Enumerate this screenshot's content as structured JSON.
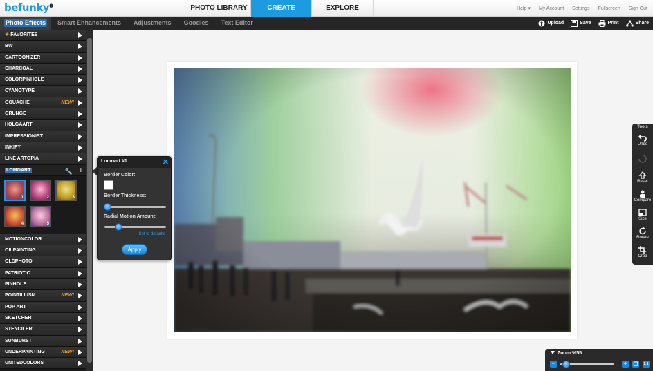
{
  "logo": {
    "text": "befunky"
  },
  "main_nav": [
    {
      "label": "PHOTO LIBRARY",
      "active": false
    },
    {
      "label": "CREATE",
      "active": true
    },
    {
      "label": "EXPLORE",
      "active": false
    }
  ],
  "top_links": [
    "Help ▾",
    "My Account",
    "Settings",
    "Fullscreen",
    "Sign Out"
  ],
  "tabs": [
    {
      "label": "Photo Effects",
      "active": true
    },
    {
      "label": "Smart Enhancements",
      "active": false
    },
    {
      "label": "Adjustments",
      "active": false
    },
    {
      "label": "Goodies",
      "active": false
    },
    {
      "label": "Text Editor",
      "active": false
    }
  ],
  "actions": [
    {
      "label": "Upload",
      "icon": "upload-icon"
    },
    {
      "label": "Save",
      "icon": "save-icon"
    },
    {
      "label": "Print",
      "icon": "print-icon"
    },
    {
      "label": "Share",
      "icon": "share-icon"
    }
  ],
  "effects_top": [
    {
      "label": "FAVORITES",
      "badge": ""
    },
    {
      "label": "BW",
      "badge": ""
    },
    {
      "label": "CARTOONIZER",
      "badge": ""
    },
    {
      "label": "CHARCOAL",
      "badge": ""
    },
    {
      "label": "COLORPINHOLE",
      "badge": ""
    },
    {
      "label": "CYANOTYPE",
      "badge": ""
    },
    {
      "label": "GOUACHE",
      "badge": "NEW!"
    },
    {
      "label": "GRUNGE",
      "badge": ""
    },
    {
      "label": "HOLGAART",
      "badge": ""
    },
    {
      "label": "IMPRESSIONIST",
      "badge": ""
    },
    {
      "label": "INKIFY",
      "badge": ""
    },
    {
      "label": "LINE ARTOPIA",
      "badge": ""
    }
  ],
  "selected_effect": {
    "label": "LOMOART"
  },
  "presets": [
    "1",
    "2",
    "3",
    "4",
    "5"
  ],
  "effects_bottom": [
    {
      "label": "MOTIONCOLOR",
      "badge": ""
    },
    {
      "label": "OILPAINTING",
      "badge": ""
    },
    {
      "label": "OLDPHOTO",
      "badge": ""
    },
    {
      "label": "PATRIOTIC",
      "badge": ""
    },
    {
      "label": "PINHOLE",
      "badge": ""
    },
    {
      "label": "POINTILLISM",
      "badge": "NEW!"
    },
    {
      "label": "POP ART",
      "badge": ""
    },
    {
      "label": "SKETCHER",
      "badge": ""
    },
    {
      "label": "STENCILER",
      "badge": ""
    },
    {
      "label": "SUNBURST",
      "badge": ""
    },
    {
      "label": "UNDERPAINTING",
      "badge": "NEW!"
    },
    {
      "label": "UNITEDCOLORS",
      "badge": ""
    }
  ],
  "popup": {
    "title": "Lomoart #1",
    "border_color_label": "Border Color:",
    "border_color": "#ffffff",
    "border_thickness_label": "Border Thickness:",
    "border_thickness": 0,
    "radial_motion_label": "Radial Motion Amount:",
    "radial_motion": 0.2,
    "defaults_link": "Set to defaults",
    "apply_label": "Apply"
  },
  "tools": {
    "title": "Tools",
    "items": [
      {
        "label": "Undo",
        "icon": "undo-icon"
      },
      {
        "label": "",
        "icon": "redo-icon"
      },
      {
        "label": "Reset",
        "icon": "reset-icon"
      },
      {
        "label": "Compare",
        "icon": "compare-icon"
      },
      {
        "label": "Size",
        "icon": "size-icon"
      },
      {
        "label": "Rotate",
        "icon": "rotate-icon"
      },
      {
        "label": "Crop",
        "icon": "crop-icon"
      }
    ]
  },
  "zoom": {
    "label": "Zoom %55",
    "level": 0.05
  },
  "colors": {
    "accent": "#1c9be0",
    "badge": "#f0a020",
    "dark": "#262626"
  }
}
